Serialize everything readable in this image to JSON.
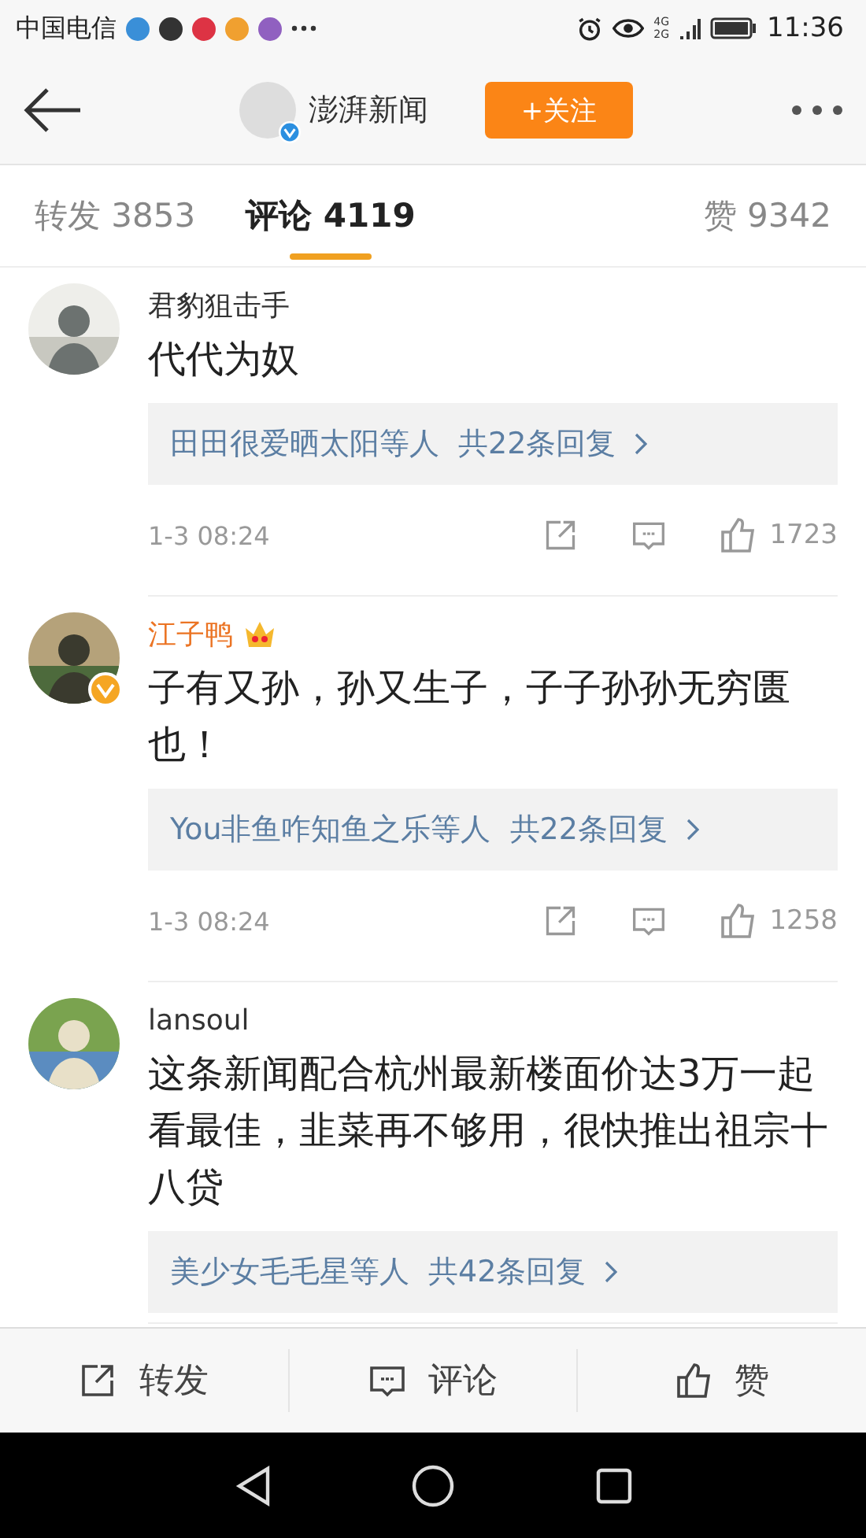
{
  "status_bar": {
    "carrier": "中国电信",
    "network_top": "4G",
    "network_bottom": "2G",
    "time": "11:36"
  },
  "header": {
    "title": "澎湃新闻",
    "verified": true,
    "follow_button": "+关注"
  },
  "tabs": [
    {
      "label": "转发 3853",
      "selected": false
    },
    {
      "label": "评论 4119",
      "selected": true
    },
    {
      "label": "赞 9342",
      "selected": false
    }
  ],
  "comments": [
    {
      "name": "君豹狙击手",
      "vip": false,
      "verified": false,
      "text": "代代为奴",
      "replies": "田田很爱晒太阳等人",
      "reply_count": "共22条回复",
      "time": "1-3 08:24",
      "likes": "1723"
    },
    {
      "name": "江子鸭",
      "vip": true,
      "verified": true,
      "text": "子有又孙，孙又生子，子子孙孙无穷匮也！",
      "replies": "You非鱼咋知鱼之乐等人",
      "reply_count": "共22条回复",
      "time": "1-3 08:24",
      "likes": "1258"
    },
    {
      "name": "lansoul",
      "vip": false,
      "verified": false,
      "text": "这条新闻配合杭州最新楼面价达3万一起看最佳，韭菜再不够用，很快推出祖宗十八贷",
      "replies": "美少女毛毛星等人",
      "reply_count": "共42条回复"
    }
  ],
  "actions": [
    {
      "kind": "repost",
      "label": "转发"
    },
    {
      "kind": "comment",
      "label": "评论"
    },
    {
      "kind": "like",
      "label": "赞"
    }
  ]
}
